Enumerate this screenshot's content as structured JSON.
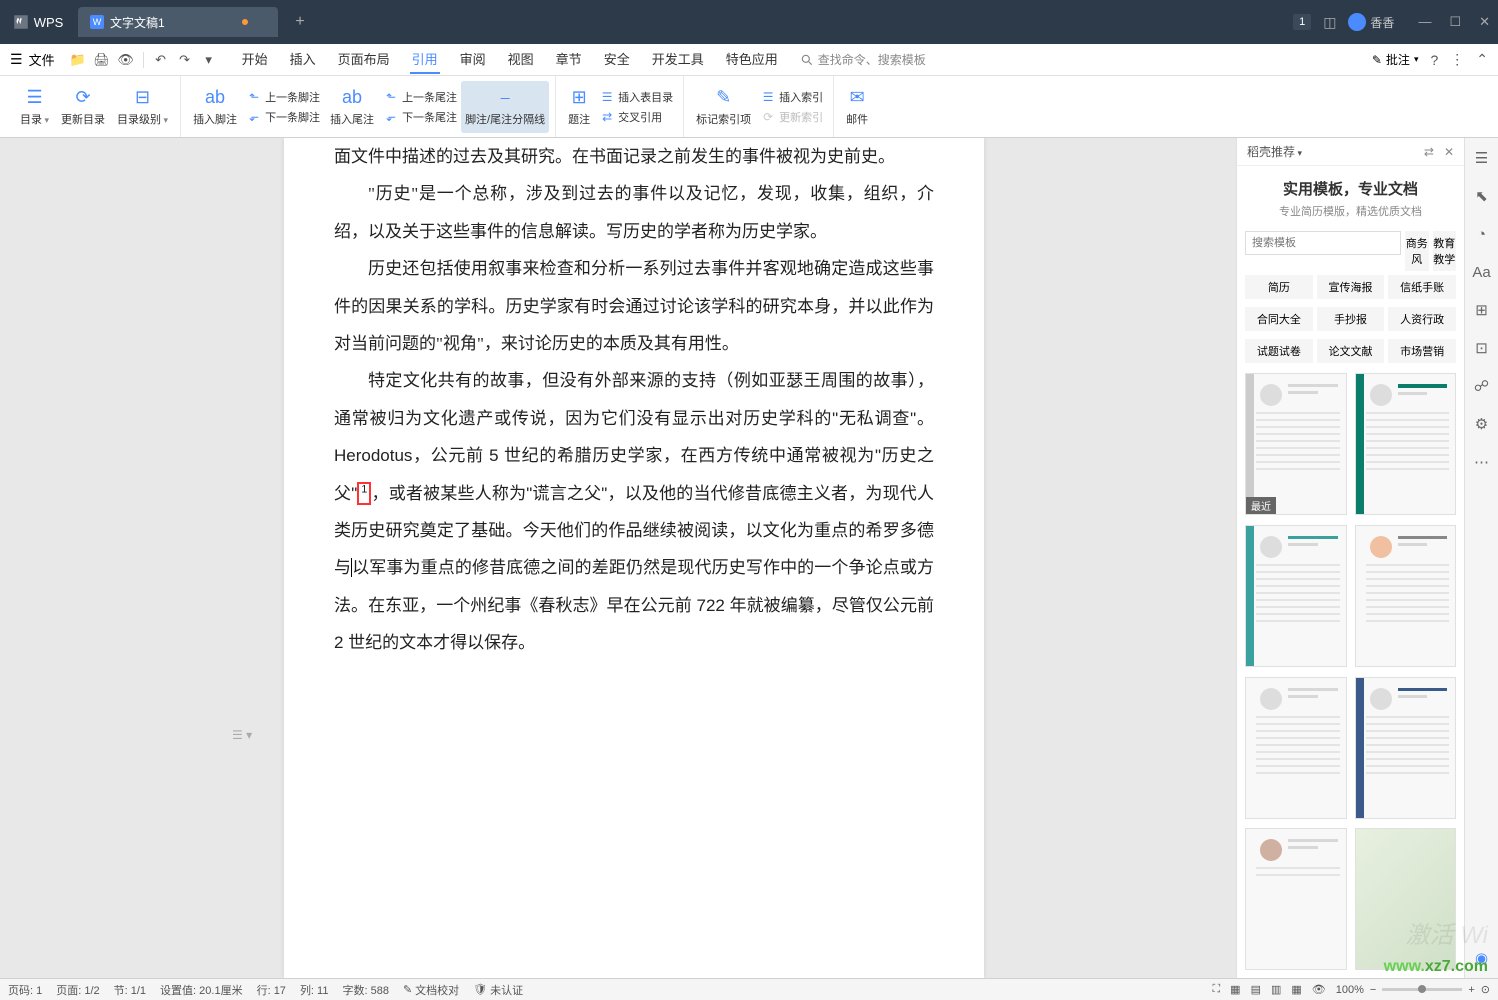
{
  "titlebar": {
    "app": "WPS",
    "tab_name": "文字文稿1",
    "user_name": "香香",
    "badge": "1"
  },
  "menubar": {
    "file": "文件",
    "tabs": [
      "开始",
      "插入",
      "页面布局",
      "引用",
      "审阅",
      "视图",
      "章节",
      "安全",
      "开发工具",
      "特色应用"
    ],
    "active_tab": "引用",
    "search_placeholder": "查找命令、搜索模板",
    "notes": "批注"
  },
  "ribbon": {
    "toc": "目录",
    "update_toc": "更新目录",
    "toc_level": "目录级别",
    "insert_footnote": "插入脚注",
    "prev_footnote": "上一条脚注",
    "next_footnote": "下一条脚注",
    "insert_endnote": "插入尾注",
    "prev_endnote": "上一条尾注",
    "next_endnote": "下一条尾注",
    "separator": "脚注/尾注分隔线",
    "caption": "题注",
    "insert_fig_toc": "插入表目录",
    "cross_ref": "交叉引用",
    "mark_index": "标记索引项",
    "insert_index": "插入索引",
    "update_index": "更新索引",
    "mail": "邮件"
  },
  "document": {
    "p1": "面文件中描述的过去及其研究。在书面记录之前发生的事件被视为史前史。",
    "p2": "\"历史\"是一个总称，涉及到过去的事件以及记忆，发现，收集，组织，介绍，以及关于这些事件的信息解读。写历史的学者称为历史学家。",
    "p3": "历史还包括使用叙事来检查和分析一系列过去事件并客观地确定造成这些事件的因果关系的学科。历史学家有时会通过讨论该学科的研究本身，并以此作为对当前问题的\"视角\"，来讨论历史的本质及其有用性。",
    "p4a": "特定文化共有的故事，但没有外部来源的支持（例如亚瑟王周围的故事），通常被归为文化遗产或传说，因为它们没有显示出对历史学科的\"无私调查\"。 Herodotus，公元前 5 世纪的希腊历史学家，在西方传统中通常被视为\"历史之父\"",
    "p4b": "，或者被某些人称为\"谎言之父\"，以及他的当代修昔底德主义者，为现代人类历史研究奠定了基础。今天他们的作品继续被阅读，以文化为重点的希罗多德与",
    "p4c": "以军事为重点的修昔底德之间的差距仍然是现代历史写作中的一个争论点或方法。在东亚，一个州纪事《春秋志》早在公元前 722 年就被编纂，尽管仅公元前 2 世纪的文本才得以保存。",
    "footnote_num": "1"
  },
  "side_panel": {
    "title": "稻壳推荐",
    "banner_title": "实用模板，专业文档",
    "banner_sub": "专业简历模版，精选优质文档",
    "search_placeholder": "搜索模板",
    "chips_row1": [
      "商务风",
      "教育教学"
    ],
    "chips_row2": [
      "简历",
      "宣传海报",
      "信纸手账"
    ],
    "chips_row3": [
      "合同大全",
      "手抄报",
      "人资行政"
    ],
    "chips_row4": [
      "试题试卷",
      "论文文献",
      "市场营销"
    ],
    "recent_badge": "最近"
  },
  "statusbar": {
    "page_num": "页码: 1",
    "page": "页面: 1/2",
    "section": "节: 1/1",
    "setting": "设置值: 20.1厘米",
    "row": "行: 17",
    "col": "列: 11",
    "words": "字数: 588",
    "proof": "文档校对",
    "cert": "未认证",
    "zoom": "100%"
  },
  "watermark1": "激活 Wi",
  "watermark2_pref": "www.",
  "watermark2": "xz7.com"
}
